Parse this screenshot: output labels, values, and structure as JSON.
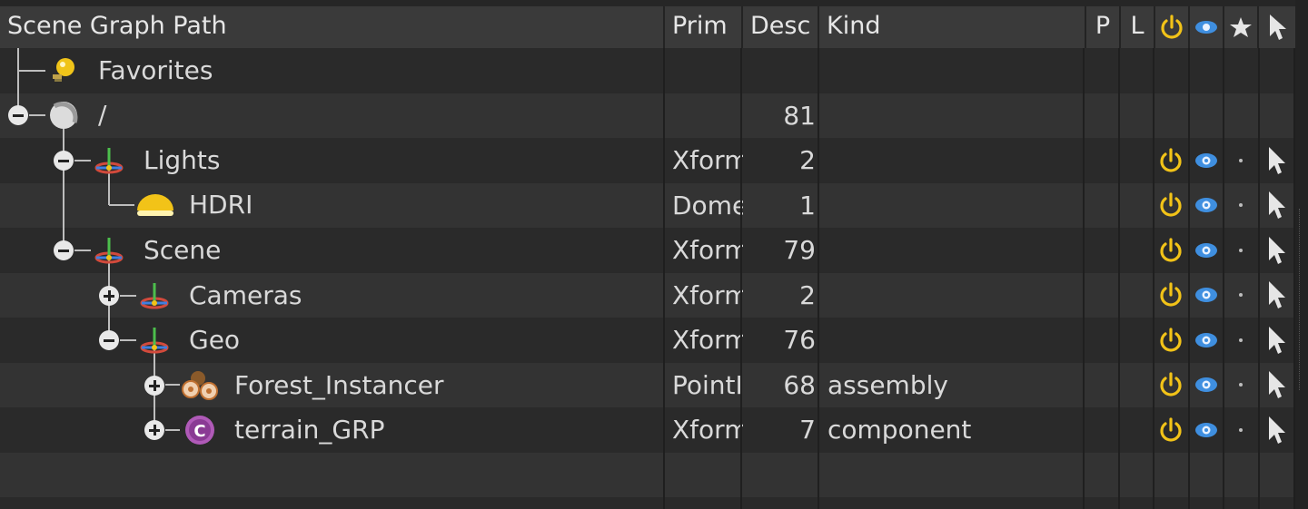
{
  "columns": {
    "path": "Scene Graph Path",
    "prim": "Prim",
    "desc": "Desc",
    "kind": "Kind",
    "p": "P",
    "l": "L",
    "active_icon": "power-icon",
    "visible_icon": "eye-icon",
    "favorite_icon": "star-icon",
    "select_icon": "pointer-icon"
  },
  "rows": [
    {
      "name": "Favorites",
      "prim": "",
      "desc": "",
      "kind": "",
      "icon": "favorites-icon",
      "flags": false
    },
    {
      "name": "/",
      "prim": "",
      "desc": "81",
      "kind": "",
      "icon": "root-sphere-icon",
      "flags": false
    },
    {
      "name": "Lights",
      "prim": "Xform",
      "desc": "2",
      "kind": "",
      "icon": "xform-icon",
      "flags": true
    },
    {
      "name": "HDRI",
      "prim": "Dome",
      "desc": "1",
      "kind": "",
      "icon": "dome-light-icon",
      "flags": true
    },
    {
      "name": "Scene",
      "prim": "Xform",
      "desc": "79",
      "kind": "",
      "icon": "xform-icon",
      "flags": true
    },
    {
      "name": "Cameras",
      "prim": "Xform",
      "desc": "2",
      "kind": "",
      "icon": "xform-icon",
      "flags": true
    },
    {
      "name": "Geo",
      "prim": "Xform",
      "desc": "76",
      "kind": "",
      "icon": "xform-icon",
      "flags": true
    },
    {
      "name": "Forest_Instancer",
      "prim": "PointI",
      "desc": "68",
      "kind": "assembly",
      "icon": "point-instancer-icon",
      "flags": true
    },
    {
      "name": "terrain_GRP",
      "prim": "Xform",
      "desc": "7",
      "kind": "component",
      "icon": "component-icon",
      "flags": true
    }
  ],
  "colors": {
    "active": "#f2c318",
    "visible": "#3f8fe0",
    "selected_name": "#e8a23a"
  }
}
